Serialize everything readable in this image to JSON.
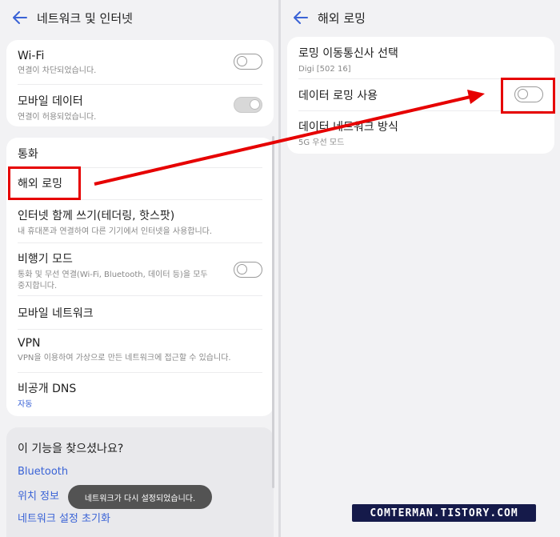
{
  "left": {
    "header_title": "네트워크 및 인터넷",
    "card1": [
      {
        "title": "Wi-Fi",
        "subtitle": "연결이 차단되었습니다."
      },
      {
        "title": "모바일 데이터",
        "subtitle": "연결이 허용되었습니다."
      }
    ],
    "card2": [
      {
        "title": "통화"
      },
      {
        "title": "해외 로밍"
      },
      {
        "title": "인터넷 함께 쓰기(테더링, 핫스팟)",
        "subtitle": "내 휴대폰과 연결하여 다른 기기에서 인터넷을 사용합니다."
      },
      {
        "title": "비행기 모드",
        "subtitle1": "통화 및 무선 연결(Wi-Fi, Bluetooth, 데이터 등)을 모두",
        "subtitle2": "중지합니다."
      },
      {
        "title": "모바일 네트워크"
      },
      {
        "title": "VPN",
        "subtitle": "VPN을 이용하여 가상으로 만든 네트워크에 접근할 수 있습니다."
      },
      {
        "title": "비공개 DNS",
        "subtitle": "자동"
      }
    ],
    "suggest": {
      "title": "이 기능을 찾으셨나요?",
      "links": [
        "Bluetooth",
        "위치 정보",
        "네트워크 설정 초기화"
      ]
    },
    "toast": "네트워크가 다시 설정되었습니다."
  },
  "right": {
    "header_title": "해외 로밍",
    "items": [
      {
        "title": "로밍 이동통신사 선택",
        "subtitle": "Digi [502 16]"
      },
      {
        "title": "데이터 로밍 사용"
      },
      {
        "title": "데이터 네트워크 방식",
        "subtitle": "5G 우선 모드"
      }
    ]
  },
  "annotation": {
    "color": "#e60000",
    "watermark": "COMTERMAN.TISTORY.COM"
  }
}
